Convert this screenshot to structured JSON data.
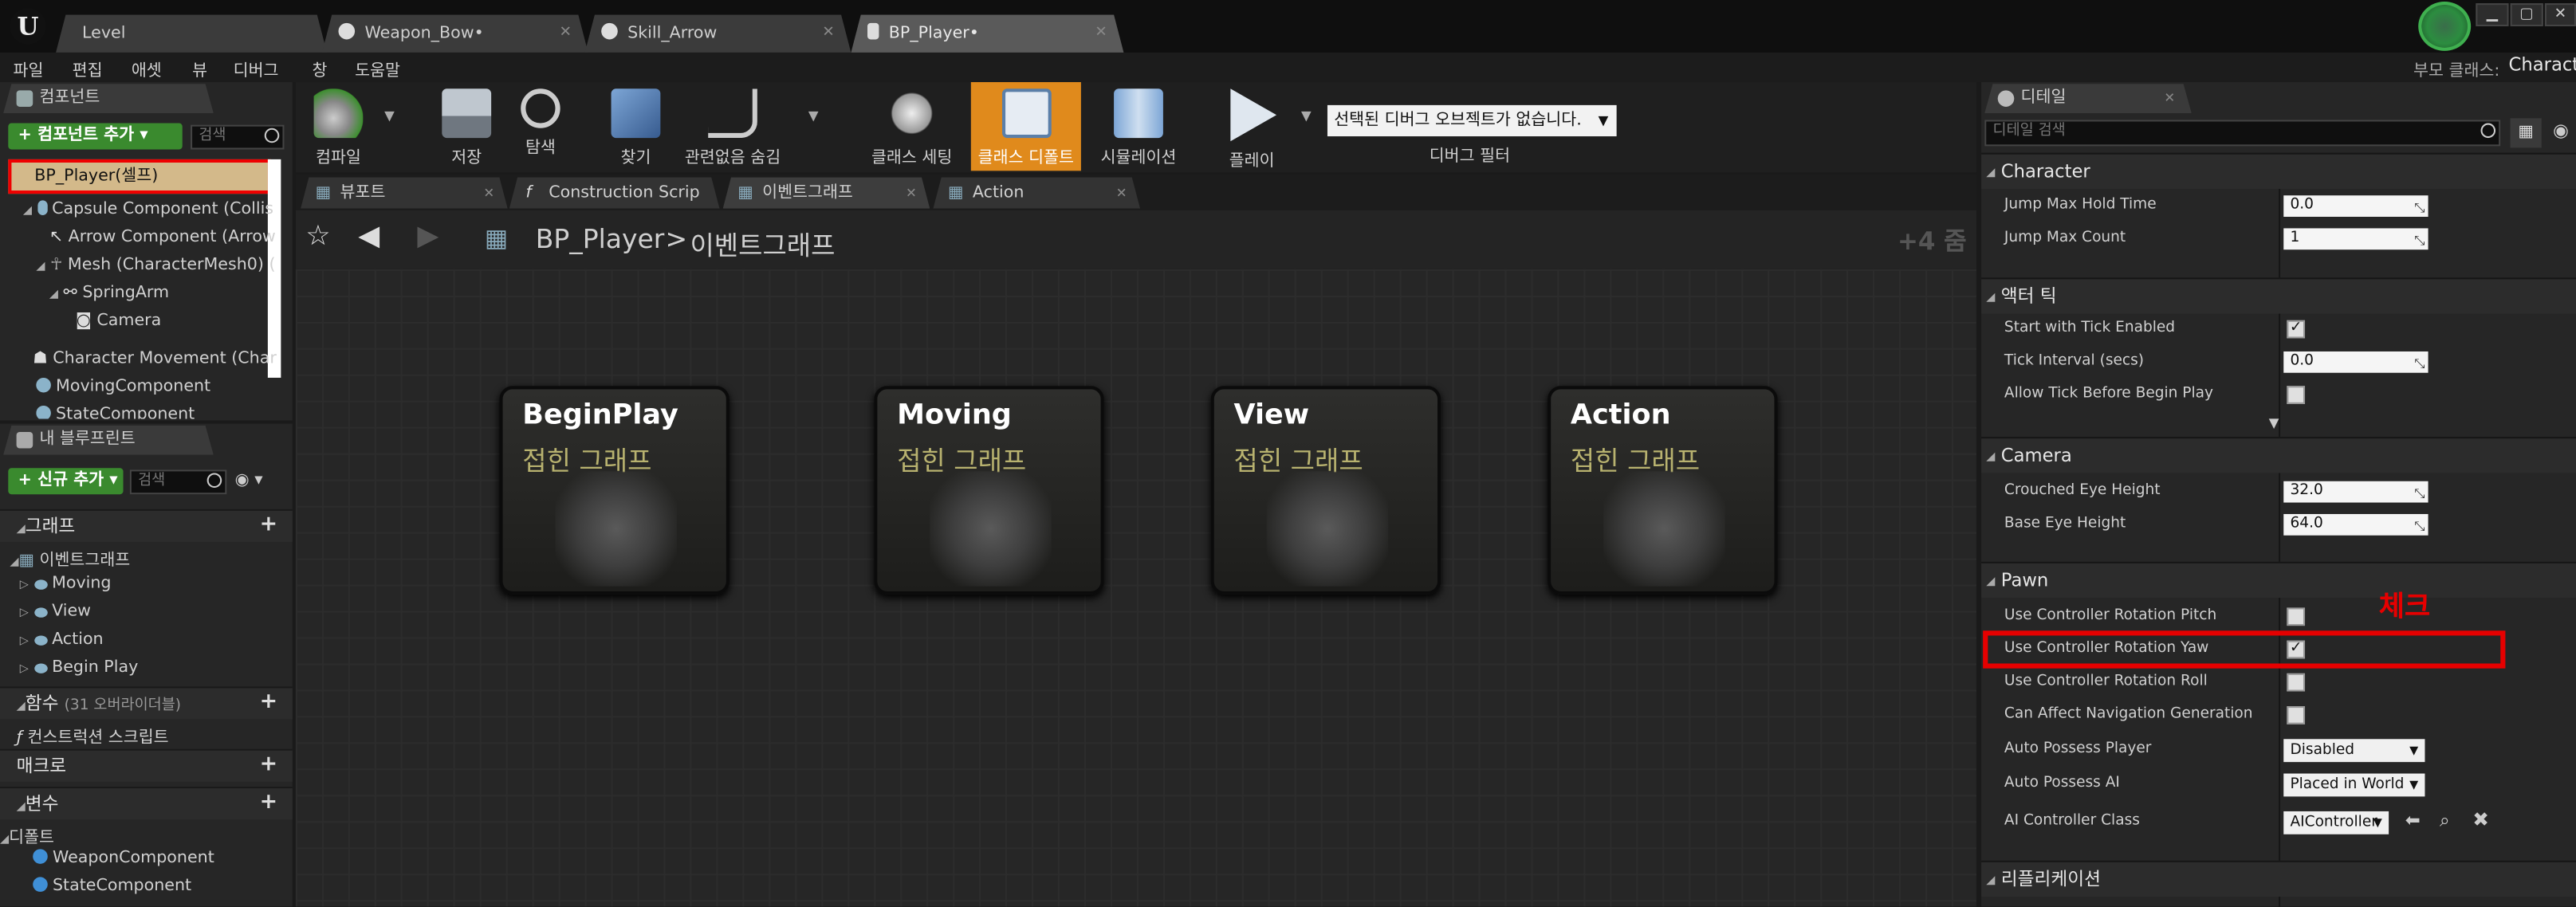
{
  "doc_tabs": [
    {
      "label": "Level",
      "active": false
    },
    {
      "label": "Weapon_Bow•",
      "active": false
    },
    {
      "label": "Skill_Arrow",
      "active": false
    },
    {
      "label": "BP_Player•",
      "active": true
    }
  ],
  "menu": [
    "파일",
    "편집",
    "애셋",
    "뷰",
    "디버그",
    "창",
    "도움말"
  ],
  "parent_class": {
    "label": "부모 클래스:",
    "value": "Charact"
  },
  "components_panel": {
    "tab": "컴포넌트",
    "add_button": "+ 컴포넌트 추가 ▾",
    "search_placeholder": "검색",
    "self_item": "BP_Player(셀프)",
    "tree": [
      "Capsule Component (Collis",
      "Arrow Component (Arrow",
      "Mesh (CharacterMesh0) (",
      "SpringArm",
      "Camera",
      "Character Movement (Char",
      "MovingComponent",
      "StateComponent"
    ]
  },
  "blueprint_panel": {
    "tab": "내 블루프린트",
    "add_button": "+ 신규 추가 ▾",
    "search_placeholder": "검색",
    "graphs_header": "그래프",
    "event_graph": "이벤트그래프",
    "graph_items": [
      "Moving",
      "View",
      "Action",
      "Begin Play"
    ],
    "functions_header": "함수",
    "functions_count": "(31 오버라이더블)",
    "construction_script": "컨스트럭션 스크립트",
    "macros_header": "매크로",
    "variables_header": "변수",
    "default_category": "디폴트",
    "variables": [
      "WeaponComponent",
      "StateComponent"
    ]
  },
  "toolbar": {
    "compile": "컴파일",
    "save": "저장",
    "browse": "탐색",
    "find": "찾기",
    "hide_unrelated": "관련없음 숨김",
    "class_settings": "클래스 세팅",
    "class_defaults": "클래스 디폴트",
    "simulation": "시뮬레이션",
    "play": "플레이",
    "debug_select": "선택된 디버그 오브젝트가 없습니다.",
    "debug_filter": "디버그 필터"
  },
  "graph_tabs": [
    {
      "label": "뷰포트",
      "active": false
    },
    {
      "label": "Construction Scrip",
      "active": false
    },
    {
      "label": "이벤트그래프",
      "active": true
    },
    {
      "label": "Action",
      "active": false
    }
  ],
  "breadcrumb": {
    "root": "BP_Player",
    "sep": ">",
    "current": "이벤트그래프",
    "zoom": "+4 줌"
  },
  "nodes": [
    {
      "title": "BeginPlay",
      "subtitle": "접힌 그래프"
    },
    {
      "title": "Moving",
      "subtitle": "접힌 그래프"
    },
    {
      "title": "View",
      "subtitle": "접힌 그래프"
    },
    {
      "title": "Action",
      "subtitle": "접힌 그래프"
    }
  ],
  "details": {
    "tab": "디테일",
    "search_placeholder": "디테일 검색",
    "character": {
      "header": "Character",
      "jump_max_hold_time_label": "Jump Max Hold Time",
      "jump_max_hold_time": "0.0",
      "jump_max_count_label": "Jump Max Count",
      "jump_max_count": "1"
    },
    "actor_tick": {
      "header": "액터 틱",
      "start_with_tick_label": "Start with Tick Enabled",
      "tick_interval_label": "Tick Interval (secs)",
      "tick_interval": "0.0",
      "allow_tick_label": "Allow Tick Before Begin Play"
    },
    "camera": {
      "header": "Camera",
      "crouched_label": "Crouched Eye Height",
      "crouched": "32.0",
      "base_label": "Base Eye Height",
      "base": "64.0"
    },
    "pawn": {
      "header": "Pawn",
      "pitch_label": "Use Controller Rotation Pitch",
      "yaw_label": "Use Controller Rotation Yaw",
      "roll_label": "Use Controller Rotation Roll",
      "nav_label": "Can Affect Navigation Generation",
      "possess_player_label": "Auto Possess Player",
      "possess_player": "Disabled",
      "possess_ai_label": "Auto Possess AI",
      "possess_ai": "Placed in World",
      "ai_controller_label": "AI Controller Class",
      "ai_controller": "AIController"
    },
    "replication_header": "리플리케이션",
    "annotation": "체크"
  }
}
